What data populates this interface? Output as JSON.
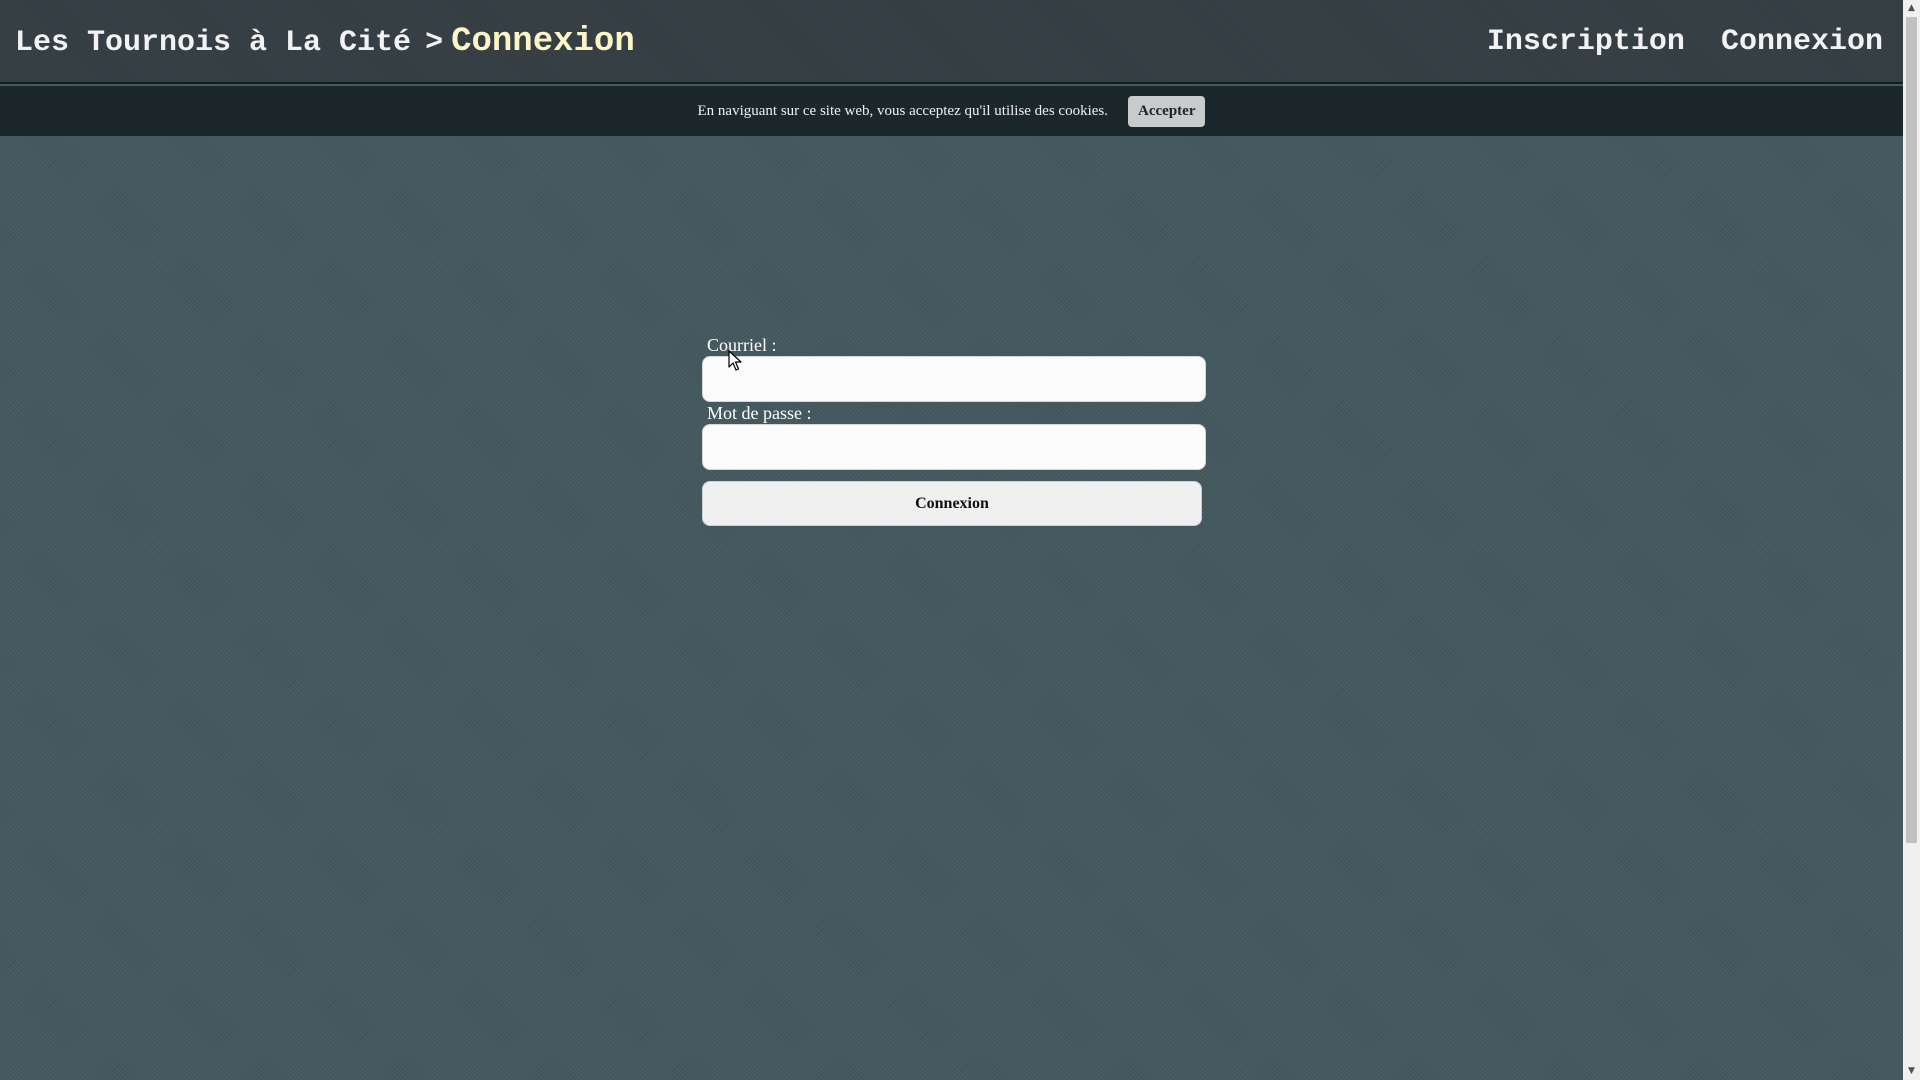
{
  "header": {
    "site_title": "Les Tournois à La Cité",
    "separator": ">",
    "current_page": "Connexion",
    "nav": {
      "signup_label": "Inscription",
      "login_label": "Connexion"
    }
  },
  "cookie_banner": {
    "message": "En naviguant sur ce site web, vous acceptez qu'il utilise des cookies.",
    "accept_label": "Accepter"
  },
  "login_form": {
    "email_label": "Courriel :",
    "email_value": "",
    "password_label": "Mot de passe :",
    "password_value": "",
    "submit_label": "Connexion"
  },
  "scrollbar": {
    "up_icon": "▲",
    "down_icon": "▼"
  },
  "colors": {
    "background": "#43585f",
    "header": "#333d42",
    "cookie_bar": "#1c272b",
    "current_page_accent": "#fbf5c8"
  }
}
